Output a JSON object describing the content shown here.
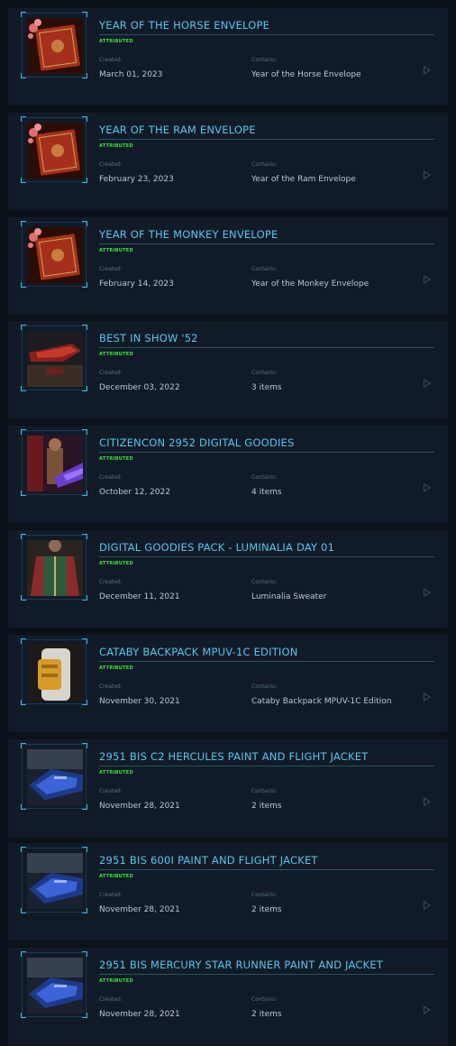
{
  "pledges": [
    {
      "title": "YEAR OF THE HORSE ENVELOPE",
      "status": "ATTRIBUTED",
      "created_label": "Created:",
      "created": "March 01, 2023",
      "contains_label": "Contains:",
      "contains": "Year of the Horse Envelope",
      "thumbnail": "red-envelope-icon"
    },
    {
      "title": "YEAR OF THE RAM ENVELOPE",
      "status": "ATTRIBUTED",
      "created_label": "Created:",
      "created": "February 23, 2023",
      "contains_label": "Contains:",
      "contains": "Year of the Ram Envelope",
      "thumbnail": "red-envelope-icon"
    },
    {
      "title": "YEAR OF THE MONKEY ENVELOPE",
      "status": "ATTRIBUTED",
      "created_label": "Created:",
      "created": "February 14, 2023",
      "contains_label": "Contains:",
      "contains": "Year of the Monkey Envelope",
      "thumbnail": "red-envelope-icon"
    },
    {
      "title": "BEST IN SHOW '52",
      "status": "ATTRIBUTED",
      "created_label": "Created:",
      "created": "December 03, 2022",
      "contains_label": "Contains:",
      "contains": "3 items",
      "thumbnail": "red-ship-icon"
    },
    {
      "title": "CITIZENCON 2952 DIGITAL GOODIES",
      "status": "ATTRIBUTED",
      "created_label": "Created:",
      "created": "October 12, 2022",
      "contains_label": "Contains:",
      "contains": "4 items",
      "thumbnail": "armored-character-icon"
    },
    {
      "title": "DIGITAL GOODIES PACK - LUMINALIA DAY 01",
      "status": "ATTRIBUTED",
      "created_label": "Created:",
      "created": "December 11, 2021",
      "contains_label": "Contains:",
      "contains": "Luminalia Sweater",
      "thumbnail": "sweater-icon"
    },
    {
      "title": "CATABY BACKPACK MPUV-1C EDITION",
      "status": "ATTRIBUTED",
      "created_label": "Created:",
      "created": "November 30, 2021",
      "contains_label": "Contains:",
      "contains": "Cataby Backpack MPUV-1C Edition",
      "thumbnail": "backpack-icon"
    },
    {
      "title": "2951 BIS C2 HERCULES PAINT AND FLIGHT JACKET",
      "status": "ATTRIBUTED",
      "created_label": "Created:",
      "created": "November 28, 2021",
      "contains_label": "Contains:",
      "contains": "2 items",
      "thumbnail": "blue-ship-icon"
    },
    {
      "title": "2951 BIS 600I PAINT AND FLIGHT JACKET",
      "status": "ATTRIBUTED",
      "created_label": "Created:",
      "created": "November 28, 2021",
      "contains_label": "Contains:",
      "contains": "2 items",
      "thumbnail": "blue-ship-icon"
    },
    {
      "title": "2951 BIS MERCURY STAR RUNNER PAINT AND JACKET",
      "status": "ATTRIBUTED",
      "created_label": "Created:",
      "created": "November 28, 2021",
      "contains_label": "Contains:",
      "contains": "2 items",
      "thumbnail": "blue-ship-icon"
    }
  ],
  "colors": {
    "title": "#5bc4ee",
    "status": "#3ee33e",
    "card": "#111b27",
    "background": "#0b1119"
  }
}
